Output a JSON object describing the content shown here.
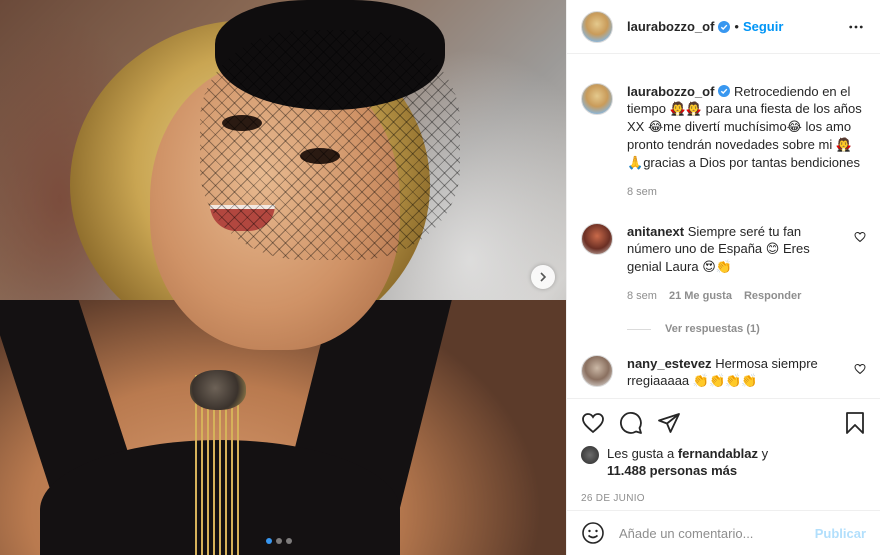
{
  "post": {
    "username": "laurabozzo_of",
    "follow_label": "Seguir",
    "separator": "•",
    "caption": {
      "text_1": "Retrocediendo en el tiempo",
      "emoji_1": "🧛🧛",
      "text_2": "para una fiesta de los años XX",
      "emoji_2": "😂",
      "text_3": "me divertí muchísimo",
      "emoji_3": "😂",
      "text_4": "los amo pronto tendrán novedades sobre mi",
      "emoji_4": "🧛🙏",
      "text_5": "gracias a Dios por tantas bendiciones",
      "time": "8 sem"
    },
    "comments": [
      {
        "username": "anitanext",
        "text": "Siempre seré tu fan número uno de España",
        "emoji_1": "😊",
        "text_2": "Eres genial Laura",
        "emoji_2": "😍👏",
        "time": "8 sem",
        "likes": "21 Me gusta",
        "reply_label": "Responder",
        "view_replies": "Ver respuestas (1)"
      },
      {
        "username": "nany_estevez",
        "text": "Hermosa siempre rregiaaaaa",
        "emoji": "👏👏👏👏"
      }
    ],
    "likes": {
      "prefix": "Les gusta a",
      "user": "fernandablaz",
      "mid": "y",
      "count": "11.488 personas más"
    },
    "date": "26 DE JUNIO",
    "comment_placeholder": "Añade un comentario...",
    "publish_label": "Publicar"
  },
  "carousel": {
    "slides": 3,
    "active_index": 0
  },
  "colors": {
    "accent": "#0095f6",
    "verified": "#3897f0",
    "muted": "#8e8e8e"
  },
  "icons": [
    "chevron-right-icon",
    "verified-icon",
    "more-icon",
    "heart-icon",
    "comment-icon",
    "share-icon",
    "bookmark-icon",
    "emoji-icon"
  ]
}
